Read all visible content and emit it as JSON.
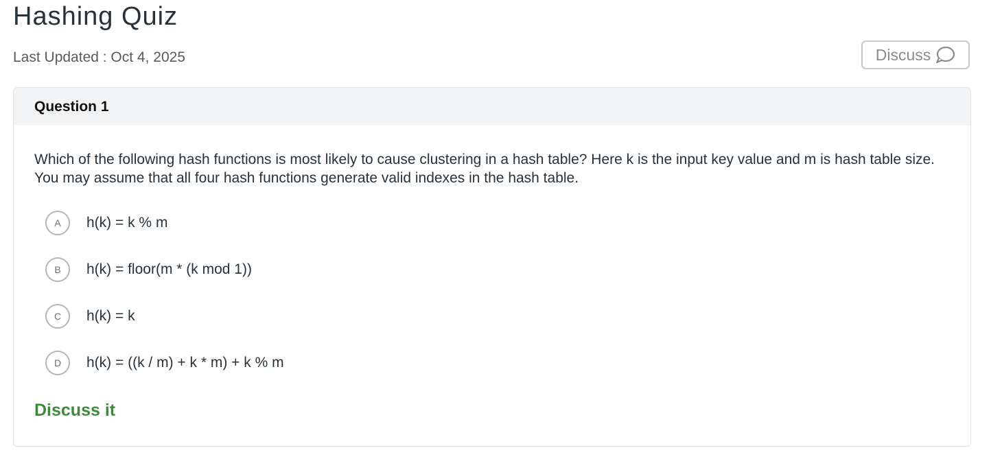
{
  "header": {
    "title": "Hashing Quiz",
    "last_updated": "Last Updated : Oct 4, 2025",
    "discuss_button_label": "Discuss",
    "discuss_icon": "speech-bubble-icon"
  },
  "question": {
    "number_label": "Question 1",
    "text": "Which of the following hash functions is most likely to cause clustering in a hash table? Here k is the input key value and m is hash table size. You may assume that all four hash functions generate valid indexes in the hash table.",
    "options": [
      {
        "letter": "A",
        "text": "h(k) = k % m"
      },
      {
        "letter": "B",
        "text": "h(k) = floor(m * (k mod 1))"
      },
      {
        "letter": "C",
        "text": "h(k) = k"
      },
      {
        "letter": "D",
        "text": "h(k) = ((k / m) + k * m) + k % m"
      }
    ],
    "discuss_link": "Discuss it"
  },
  "colors": {
    "discuss_link": "#3f8a3a",
    "header_bg": "#f2f3f4",
    "border": "#e3e3e3"
  }
}
